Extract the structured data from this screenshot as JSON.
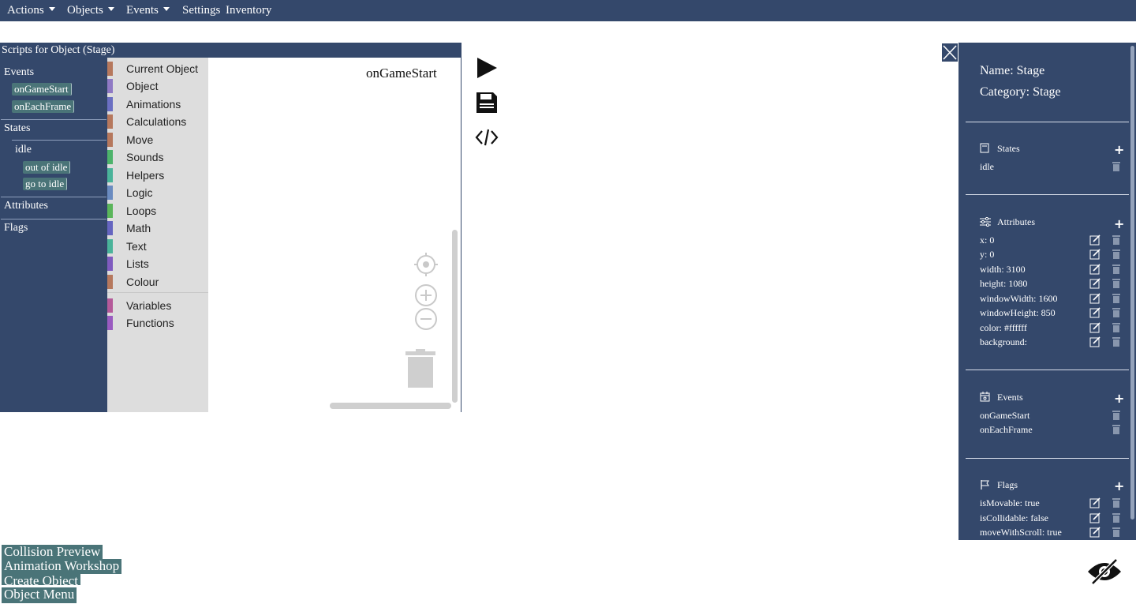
{
  "topbar": {
    "menus": [
      {
        "label": "Actions"
      },
      {
        "label": "Objects"
      },
      {
        "label": "Events"
      },
      {
        "label": "Settings"
      },
      {
        "label": "Inventory"
      }
    ]
  },
  "scripts_panel": {
    "title": "Scripts for Object (Stage)",
    "nav": {
      "events_label": "Events",
      "events": [
        "onGameStart",
        "onEachFrame"
      ],
      "states_label": "States",
      "state_name": "idle",
      "state_actions": [
        "out of idle",
        "go to idle"
      ],
      "attributes_label": "Attributes",
      "flags_label": "Flags"
    },
    "toolbox": [
      {
        "label": "Current Object",
        "color": "#b6785d"
      },
      {
        "label": "Object",
        "color": "#8f79c4"
      },
      {
        "label": "Animations",
        "color": "#6b6fc2"
      },
      {
        "label": "Calculations",
        "color": "#b6785d"
      },
      {
        "label": "Move",
        "color": "#b6785d"
      },
      {
        "label": "Sounds",
        "color": "#4db36b"
      },
      {
        "label": "Helpers",
        "color": "#4ab39a"
      },
      {
        "label": "Logic",
        "color": "#6a8bc0"
      },
      {
        "label": "Loops",
        "color": "#5ab55a"
      },
      {
        "label": "Math",
        "color": "#6565c0"
      },
      {
        "label": "Text",
        "color": "#4ab39a"
      },
      {
        "label": "Lists",
        "color": "#7f5bbf"
      },
      {
        "label": "Colour",
        "color": "#b6785d"
      },
      {
        "label": "Variables",
        "color": "#b55a9a"
      },
      {
        "label": "Functions",
        "color": "#9a5bc0"
      }
    ],
    "workspace_title": "onGameStart"
  },
  "object_panel": {
    "name": "Name: Stage",
    "category": "Category: Stage",
    "states": {
      "title": "States",
      "items": [
        "idle"
      ]
    },
    "attributes": {
      "title": "Attributes",
      "items": [
        "x: 0",
        "y: 0",
        "width: 3100",
        "height: 1080",
        "windowWidth: 1600",
        "windowHeight: 850",
        "color: #ffffff",
        "background:"
      ]
    },
    "events": {
      "title": "Events",
      "items": [
        "onGameStart",
        "onEachFrame"
      ]
    },
    "flags": {
      "title": "Flags",
      "items": [
        "isMovable: true",
        "isCollidable: false",
        "moveWithScroll: true"
      ]
    }
  },
  "bottom_buttons": [
    "Collision Preview",
    "Animation Workshop",
    "Create Object",
    "Object Menu"
  ]
}
